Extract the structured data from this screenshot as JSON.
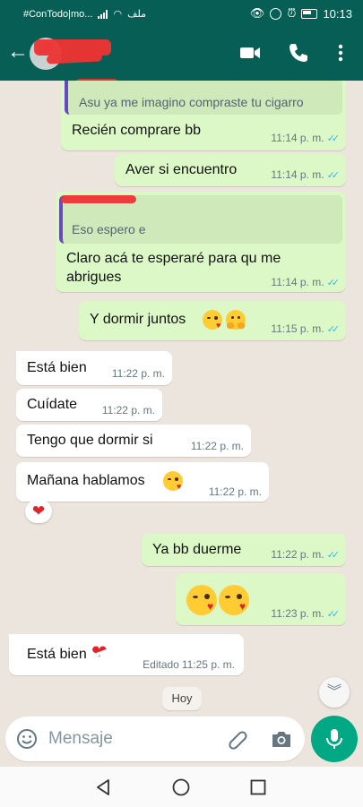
{
  "status_bar": {
    "carrier": "#ConTodo|mo...",
    "time": "10:13",
    "network_glyph": "ملف"
  },
  "header": {
    "contact_name": ""
  },
  "messages": [
    {
      "direction": "out",
      "quoted": "Asu ya me imagino compraste tu  cigarro",
      "text": "Recién comprare bb",
      "time": "11:14 p. m.",
      "status": "read"
    },
    {
      "direction": "out",
      "text": "Aver si encuentro",
      "time": "11:14 p. m.",
      "status": "read"
    },
    {
      "direction": "out",
      "quoted": "Eso espero e",
      "text_lines": [
        "Claro acá te esperaré para qu me",
        "abrigues"
      ],
      "time": "11:14 p. m.",
      "status": "read"
    },
    {
      "direction": "out",
      "text": "Y dormir juntos",
      "emojis": [
        "kissing-heart-emoji",
        "hugging-emoji"
      ],
      "time": "11:15 p. m.",
      "status": "read"
    },
    {
      "direction": "in",
      "text": "Está bien",
      "time": "11:22 p. m."
    },
    {
      "direction": "in",
      "text": "Cuídate",
      "time": "11:22 p. m."
    },
    {
      "direction": "in",
      "text": "Tengo que dormir si",
      "time": "11:22 p. m."
    },
    {
      "direction": "in",
      "text": "Mañana hablamos",
      "emojis": [
        "kissing-heart-emoji"
      ],
      "time": "11:22 p. m.",
      "reaction": "❤"
    },
    {
      "direction": "out",
      "text": "Ya bb duerme",
      "time": "11:22 p. m.",
      "status": "read"
    },
    {
      "direction": "out",
      "text": "",
      "emojis": [
        "kissing-heart-emoji",
        "kissing-heart-emoji"
      ],
      "time": "11:23 p. m.",
      "status": "read"
    },
    {
      "direction": "in",
      "text": "Está bien",
      "emojis": [
        "heart-bandage-emoji"
      ],
      "edited_label": "Editado",
      "time": "11:25 p. m."
    }
  ],
  "date_chip": "Hoy",
  "input": {
    "placeholder": "Mensaje"
  },
  "colors": {
    "header": "#075e54",
    "outgoing_bubble": "#dcf8c6",
    "incoming_bubble": "#ffffff",
    "read_ticks": "#34b7f1",
    "mic_button": "#00a884",
    "background": "#ece5dd"
  },
  "icons": [
    "back-arrow-icon",
    "video-call-icon",
    "phone-icon",
    "more-vert-icon",
    "emoji-icon",
    "attach-icon",
    "camera-icon",
    "mic-icon",
    "chevron-down-icon",
    "nav-back-icon",
    "nav-home-icon",
    "nav-recents-icon"
  ]
}
